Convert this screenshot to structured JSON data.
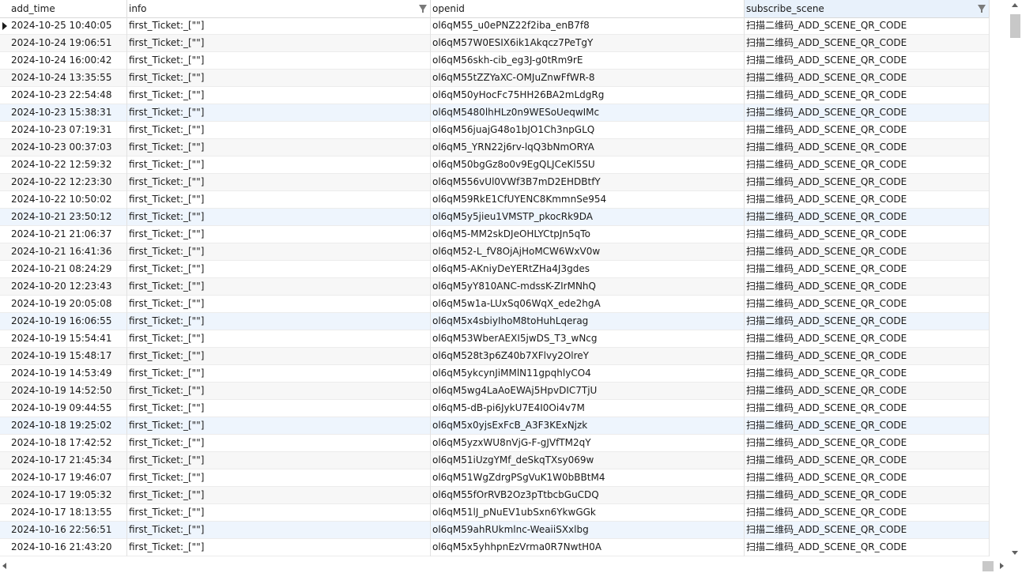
{
  "columns": [
    {
      "label": "add_time"
    },
    {
      "label": "info"
    },
    {
      "label": "openid"
    },
    {
      "label": "subscribe_scene"
    }
  ],
  "rows": [
    {
      "add_time": "2024-10-25 10:40:05",
      "info": "first_Ticket:_[\"\"]",
      "openid": "ol6qM55_u0ePNZ22f2iba_enB7f8",
      "subscribe_scene": "扫描二维码_ADD_SCENE_QR_CODE"
    },
    {
      "add_time": "2024-10-24 19:06:51",
      "info": "first_Ticket:_[\"\"]",
      "openid": "ol6qM57W0ESIX6ik1Akqcz7PeTgY",
      "subscribe_scene": "扫描二维码_ADD_SCENE_QR_CODE"
    },
    {
      "add_time": "2024-10-24 16:00:42",
      "info": "first_Ticket:_[\"\"]",
      "openid": "ol6qM56skh-cib_eg3J-g0tRm9rE",
      "subscribe_scene": "扫描二维码_ADD_SCENE_QR_CODE"
    },
    {
      "add_time": "2024-10-24 13:35:55",
      "info": "first_Ticket:_[\"\"]",
      "openid": "ol6qM55tZZYaXC-OMJuZnwFfWR-8",
      "subscribe_scene": "扫描二维码_ADD_SCENE_QR_CODE"
    },
    {
      "add_time": "2024-10-23 22:54:48",
      "info": "first_Ticket:_[\"\"]",
      "openid": "ol6qM50yHocFc75HH26BA2mLdgRg",
      "subscribe_scene": "扫描二维码_ADD_SCENE_QR_CODE"
    },
    {
      "add_time": "2024-10-23 15:38:31",
      "info": "first_Ticket:_[\"\"]",
      "openid": "ol6qM5480lhHLz0n9WESoUeqwIMc",
      "subscribe_scene": "扫描二维码_ADD_SCENE_QR_CODE"
    },
    {
      "add_time": "2024-10-23 07:19:31",
      "info": "first_Ticket:_[\"\"]",
      "openid": "ol6qM56juajG48o1bJO1Ch3npGLQ",
      "subscribe_scene": "扫描二维码_ADD_SCENE_QR_CODE"
    },
    {
      "add_time": "2024-10-23 00:37:03",
      "info": "first_Ticket:_[\"\"]",
      "openid": "ol6qM5_YRN22j6rv-lqQ3bNmORYA",
      "subscribe_scene": "扫描二维码_ADD_SCENE_QR_CODE"
    },
    {
      "add_time": "2024-10-22 12:59:32",
      "info": "first_Ticket:_[\"\"]",
      "openid": "ol6qM50bgGz8o0v9EgQLJCeKl5SU",
      "subscribe_scene": "扫描二维码_ADD_SCENE_QR_CODE"
    },
    {
      "add_time": "2024-10-22 12:23:30",
      "info": "first_Ticket:_[\"\"]",
      "openid": "ol6qM556vUl0VWf3B7mD2EHDBtfY",
      "subscribe_scene": "扫描二维码_ADD_SCENE_QR_CODE"
    },
    {
      "add_time": "2024-10-22 10:50:02",
      "info": "first_Ticket:_[\"\"]",
      "openid": "ol6qM59RkE1CfUYENC8KmmnSe954",
      "subscribe_scene": "扫描二维码_ADD_SCENE_QR_CODE"
    },
    {
      "add_time": "2024-10-21 23:50:12",
      "info": "first_Ticket:_[\"\"]",
      "openid": "ol6qM5y5jieu1VMSTP_pkocRk9DA",
      "subscribe_scene": "扫描二维码_ADD_SCENE_QR_CODE"
    },
    {
      "add_time": "2024-10-21 21:06:37",
      "info": "first_Ticket:_[\"\"]",
      "openid": "ol6qM5-MM2skDJeOHLYCtpJn5qTo",
      "subscribe_scene": "扫描二维码_ADD_SCENE_QR_CODE"
    },
    {
      "add_time": "2024-10-21 16:41:36",
      "info": "first_Ticket:_[\"\"]",
      "openid": "ol6qM52-L_fV8OjAjHoMCW6WxV0w",
      "subscribe_scene": "扫描二维码_ADD_SCENE_QR_CODE"
    },
    {
      "add_time": "2024-10-21 08:24:29",
      "info": "first_Ticket:_[\"\"]",
      "openid": "ol6qM5-AKniyDeYERtZHa4J3gdes",
      "subscribe_scene": "扫描二维码_ADD_SCENE_QR_CODE"
    },
    {
      "add_time": "2024-10-20 12:23:43",
      "info": "first_Ticket:_[\"\"]",
      "openid": "ol6qM5yY810ANC-mdssK-ZIrMNhQ",
      "subscribe_scene": "扫描二维码_ADD_SCENE_QR_CODE"
    },
    {
      "add_time": "2024-10-19 20:05:08",
      "info": "first_Ticket:_[\"\"]",
      "openid": "ol6qM5w1a-LUxSq06WqX_ede2hgA",
      "subscribe_scene": "扫描二维码_ADD_SCENE_QR_CODE"
    },
    {
      "add_time": "2024-10-19 16:06:55",
      "info": "first_Ticket:_[\"\"]",
      "openid": "ol6qM5x4sbiyIhoM8toHuhLqerag",
      "subscribe_scene": "扫描二维码_ADD_SCENE_QR_CODE"
    },
    {
      "add_time": "2024-10-19 15:54:41",
      "info": "first_Ticket:_[\"\"]",
      "openid": "ol6qM53WberAEXI5jwDS_T3_wNcg",
      "subscribe_scene": "扫描二维码_ADD_SCENE_QR_CODE"
    },
    {
      "add_time": "2024-10-19 15:48:17",
      "info": "first_Ticket:_[\"\"]",
      "openid": "ol6qM528t3p6Z40b7XFlvy2OlreY",
      "subscribe_scene": "扫描二维码_ADD_SCENE_QR_CODE"
    },
    {
      "add_time": "2024-10-19 14:53:49",
      "info": "first_Ticket:_[\"\"]",
      "openid": "ol6qM5ykcynJiMMlN11gpqhlyCO4",
      "subscribe_scene": "扫描二维码_ADD_SCENE_QR_CODE"
    },
    {
      "add_time": "2024-10-19 14:52:50",
      "info": "first_Ticket:_[\"\"]",
      "openid": "ol6qM5wg4LaAoEWAj5HpvDIC7TjU",
      "subscribe_scene": "扫描二维码_ADD_SCENE_QR_CODE"
    },
    {
      "add_time": "2024-10-19 09:44:55",
      "info": "first_Ticket:_[\"\"]",
      "openid": "ol6qM5-dB-pi6JykU7E4I0Oi4v7M",
      "subscribe_scene": "扫描二维码_ADD_SCENE_QR_CODE"
    },
    {
      "add_time": "2024-10-18 19:25:02",
      "info": "first_Ticket:_[\"\"]",
      "openid": "ol6qM5x0yjsExFcB_A3F3KExNjzk",
      "subscribe_scene": "扫描二维码_ADD_SCENE_QR_CODE"
    },
    {
      "add_time": "2024-10-18 17:42:52",
      "info": "first_Ticket:_[\"\"]",
      "openid": "ol6qM5yzxWU8nVjG-F-gJVfTM2qY",
      "subscribe_scene": "扫描二维码_ADD_SCENE_QR_CODE"
    },
    {
      "add_time": "2024-10-17 21:45:34",
      "info": "first_Ticket:_[\"\"]",
      "openid": "ol6qM51iUzgYMf_deSkqTXsy069w",
      "subscribe_scene": "扫描二维码_ADD_SCENE_QR_CODE"
    },
    {
      "add_time": "2024-10-17 19:46:07",
      "info": "first_Ticket:_[\"\"]",
      "openid": "ol6qM51WgZdrgPSgVuK1W0bBBtM4",
      "subscribe_scene": "扫描二维码_ADD_SCENE_QR_CODE"
    },
    {
      "add_time": "2024-10-17 19:05:32",
      "info": "first_Ticket:_[\"\"]",
      "openid": "ol6qM55fOrRVB2Oz3pTtbcbGuCDQ",
      "subscribe_scene": "扫描二维码_ADD_SCENE_QR_CODE"
    },
    {
      "add_time": "2024-10-17 18:13:55",
      "info": "first_Ticket:_[\"\"]",
      "openid": "ol6qM51lJ_pNuEV1ubSxn6YkwGGk",
      "subscribe_scene": "扫描二维码_ADD_SCENE_QR_CODE"
    },
    {
      "add_time": "2024-10-16 22:56:51",
      "info": "first_Ticket:_[\"\"]",
      "openid": "ol6qM59ahRUkmlnc-WeaiiSXxlbg",
      "subscribe_scene": "扫描二维码_ADD_SCENE_QR_CODE"
    },
    {
      "add_time": "2024-10-16 21:43:20",
      "info": "first_Ticket:_[\"\"]",
      "openid": "ol6qM5x5yhhpnEzVrma0R7NwtH0A",
      "subscribe_scene": "扫描二维码_ADD_SCENE_QR_CODE"
    }
  ],
  "colors": {
    "selected_header": "#e8f1fb",
    "highlight_row": "#eef5fd",
    "alt_row": "#f7f7f7"
  }
}
